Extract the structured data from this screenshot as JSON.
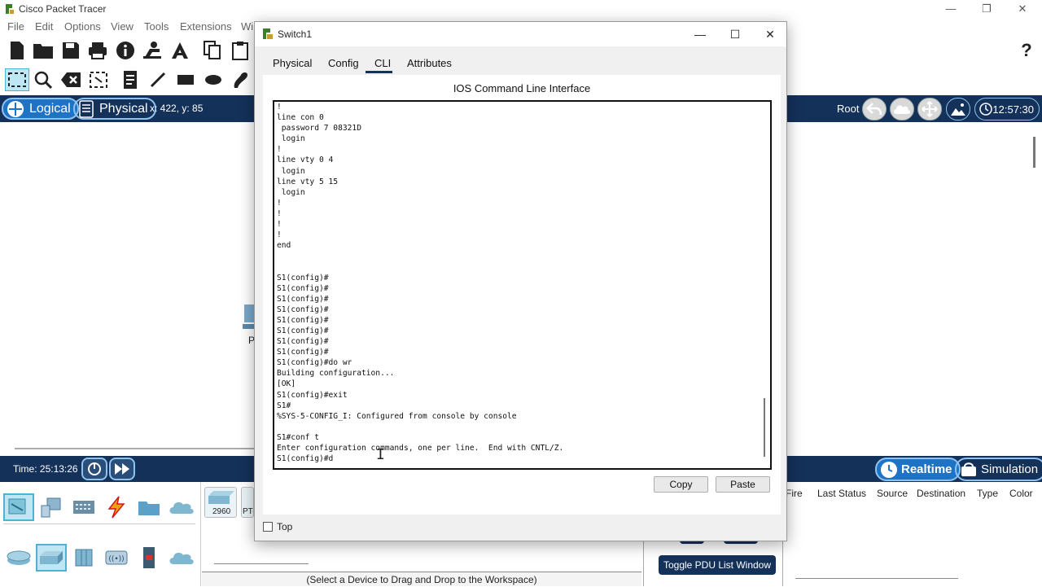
{
  "app": {
    "title": "Cisco Packet Tracer",
    "window_controls": [
      "minimize",
      "restore",
      "close"
    ]
  },
  "menu": {
    "items": [
      "File",
      "Edit",
      "Options",
      "View",
      "Tools",
      "Extensions",
      "Wi"
    ]
  },
  "toolbar": {
    "icons": [
      "new-icon",
      "open-icon",
      "save-icon",
      "print-icon",
      "info-icon",
      "network-icon",
      "activity-wizard-icon",
      "copy-icon",
      "paste-icon",
      "help-icon"
    ],
    "help_glyph": "?"
  },
  "drawbar": {
    "icons": [
      "select-icon",
      "zoom-icon",
      "delete-icon",
      "resize-icon",
      "note-icon",
      "line-icon",
      "rectangle-icon",
      "ellipse-icon",
      "freeform-icon"
    ]
  },
  "modebar": {
    "logical_label": "Logical",
    "physical_label": "Physical",
    "coords": "x: 422, y: 85",
    "root_label": "Root",
    "clock": "12:57:30"
  },
  "timebar": {
    "time": "Time: 25:13:26",
    "realtime_label": "Realtime",
    "simulation_label": "Simulation"
  },
  "device_panel": {
    "sub_device_labels": [
      "2960",
      "PT-"
    ],
    "drag_hint": "(Select a Device to Drag and Drop to the Workspace)"
  },
  "pdu_panel": {
    "headers": [
      "Fire",
      "Last Status",
      "Source",
      "Destination",
      "Type",
      "Color"
    ],
    "toggle_label": "Toggle PDU List Window"
  },
  "workspace": {
    "partial_label": "P"
  },
  "dialog": {
    "title": "Switch1",
    "tabs": [
      "Physical",
      "Config",
      "CLI",
      "Attributes"
    ],
    "active_tab": "CLI",
    "heading": "IOS Command Line Interface",
    "terminal_text": "!\nline con 0\n password 7 08321D\n login\n!\nline vty 0 4\n login\nline vty 5 15\n login\n!\n!\n!\n!\nend\n\n\nS1(config)#\nS1(config)#\nS1(config)#\nS1(config)#\nS1(config)#\nS1(config)#\nS1(config)#\nS1(config)#\nS1(config)#do wr\nBuilding configuration...\n[OK]\nS1(config)#exit\nS1#\n%SYS-5-CONFIG_I: Configured from console by console\n\nS1#conf t\nEnter configuration commands, one per line.  End with CNTL/Z.\nS1(config)#d",
    "copy_label": "Copy",
    "paste_label": "Paste",
    "top_checkbox_label": "Top"
  },
  "colors": {
    "navy_bar": "#14315a",
    "active_pill": "#1f73c4",
    "pill_border": "#8ec3ef"
  }
}
